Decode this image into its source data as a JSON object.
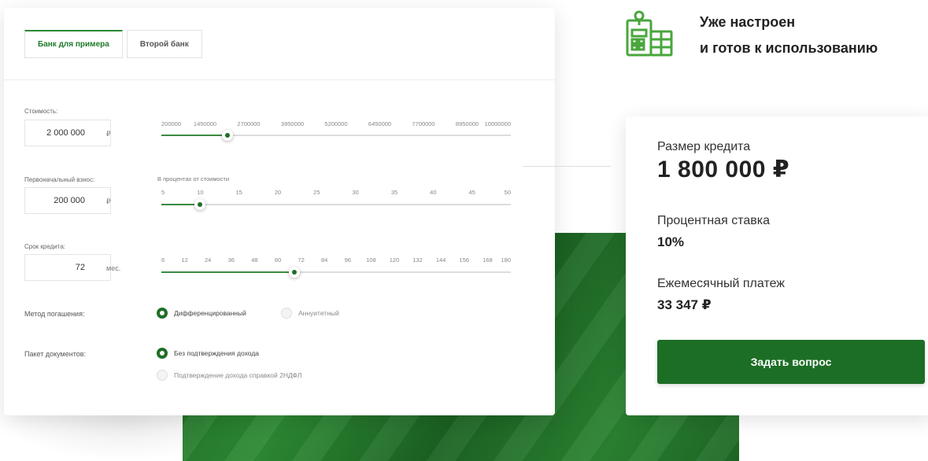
{
  "tabs": [
    "Банк для примера",
    "Второй банк"
  ],
  "cost": {
    "label": "Стоимость:",
    "value": "2 000 000",
    "unit": "₽",
    "ticks": [
      "200000",
      "1450000",
      "2700000",
      "3950000",
      "5200000",
      "6450000",
      "7700000",
      "8950000",
      "10000000"
    ],
    "slider_fraction": 0.19
  },
  "down_payment": {
    "label": "Первоначальный взнос:",
    "value": "200 000",
    "unit": "₽",
    "sublabel": "В процентах от стоимости",
    "ticks": [
      "5",
      "10",
      "15",
      "20",
      "25",
      "30",
      "35",
      "40",
      "45",
      "50"
    ],
    "slider_fraction": 0.11
  },
  "term": {
    "label": "Срок кредита:",
    "value": "72",
    "unit": "мес.",
    "ticks": [
      "6",
      "12",
      "24",
      "36",
      "48",
      "60",
      "72",
      "84",
      "96",
      "108",
      "120",
      "132",
      "144",
      "156",
      "168",
      "180"
    ],
    "slider_fraction": 0.38
  },
  "repayment": {
    "label": "Метод погашения:",
    "options": [
      "Дифференцированный",
      "Аннуитетный"
    ],
    "selected": 0
  },
  "documents": {
    "label": "Пакет документов:",
    "options": [
      "Без подтверждения дохода",
      "Подтверждение дохода справкой 2НДФЛ"
    ],
    "selected": 0
  },
  "feature": {
    "line1": "Уже настроен",
    "line2": "и готов к использованию",
    "icon": "calculator-document-icon"
  },
  "result": {
    "loan_label": "Размер кредита",
    "loan_value": "1 800 000 ₽",
    "rate_label": "Процентная ставка",
    "rate_value": "10%",
    "payment_label": "Ежемесячный платеж",
    "payment_value": "33 347 ₽",
    "ask_button": "Задать вопрос"
  },
  "colors": {
    "accent": "#1f6e26",
    "slider_fill": "#3a8a41",
    "icon_green": "#4aa63d"
  }
}
